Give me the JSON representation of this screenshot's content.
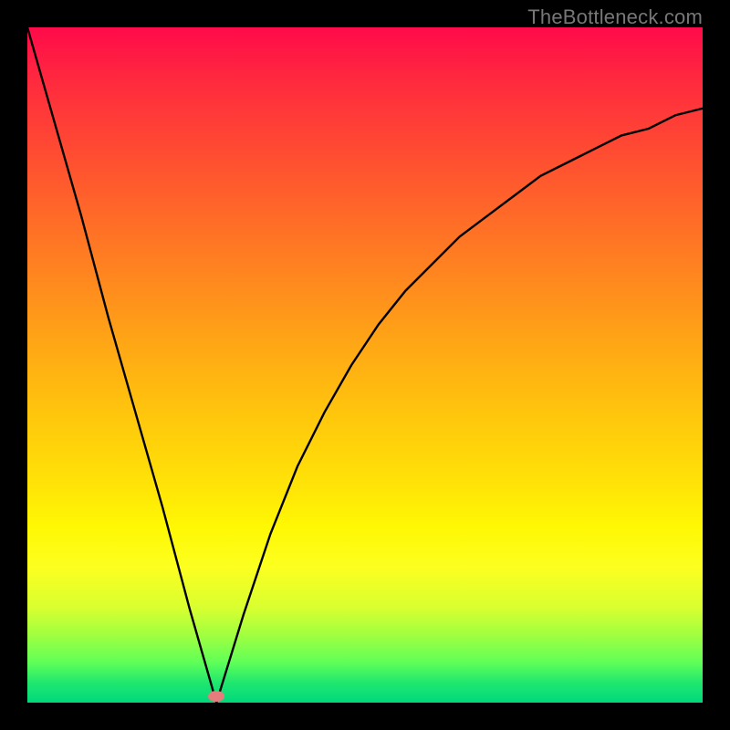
{
  "watermark": "TheBottleneck.com",
  "colors": {
    "frame": "#000000",
    "curve": "#000000",
    "marker": "#e77c7c",
    "gradient_top": "#ff0a4a",
    "gradient_bottom": "#00d87c"
  },
  "chart_data": {
    "type": "line",
    "title": "",
    "xlabel": "",
    "ylabel": "",
    "xlim": [
      0,
      100
    ],
    "ylim": [
      0,
      100
    ],
    "grid": false,
    "legend": false,
    "annotation": "TheBottleneck.com",
    "marker": {
      "x": 28,
      "y": 1
    },
    "series": [
      {
        "name": "left-branch",
        "x": [
          0,
          4,
          8,
          12,
          16,
          20,
          24,
          28
        ],
        "values": [
          100,
          86,
          72,
          57,
          43,
          29,
          14,
          0
        ]
      },
      {
        "name": "right-branch",
        "x": [
          28,
          32,
          36,
          40,
          44,
          48,
          52,
          56,
          60,
          64,
          68,
          72,
          76,
          80,
          84,
          88,
          92,
          96,
          100
        ],
        "values": [
          0,
          13,
          25,
          35,
          43,
          50,
          56,
          61,
          65,
          69,
          72,
          75,
          78,
          80,
          82,
          84,
          85,
          87,
          88
        ]
      }
    ]
  }
}
